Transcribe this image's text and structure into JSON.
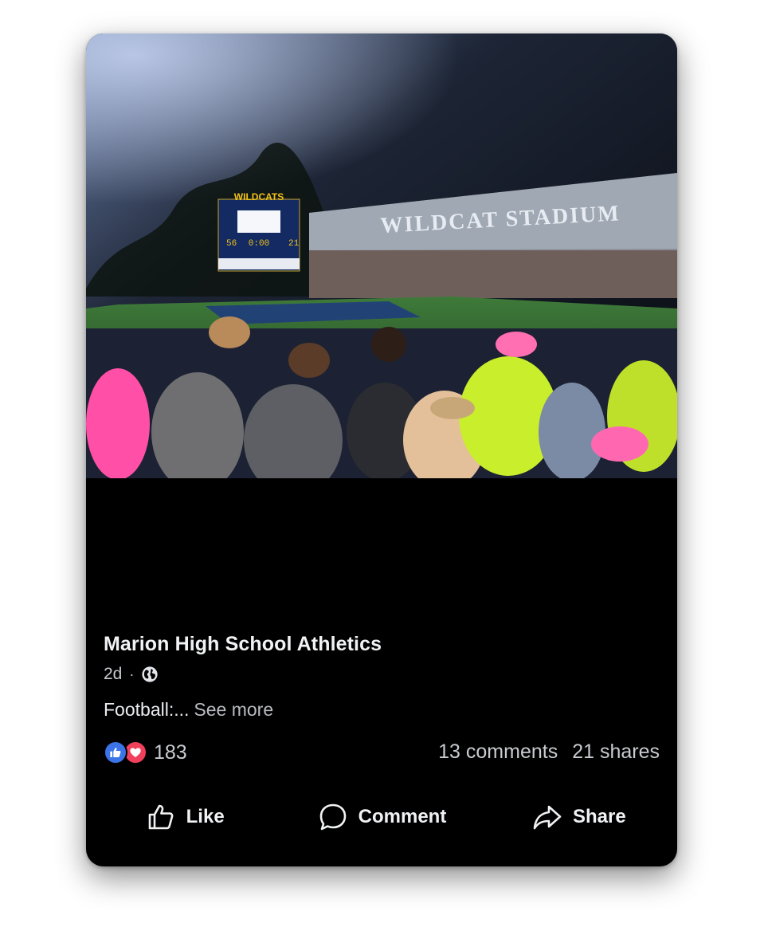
{
  "post": {
    "page_name": "Marion High School Athletics",
    "time_ago": "2d",
    "separator": "·",
    "privacy_icon": "globe-icon",
    "caption": "Football:...",
    "see_more": "See more",
    "photo": {
      "scoreboard_title": "WILDCATS",
      "building_sign": "WILDCAT STADIUM",
      "scoreboard_home_score": "56",
      "scoreboard_clock": "0:00",
      "scoreboard_away_score": "21"
    }
  },
  "stats": {
    "reaction_icons": [
      "like-reaction-icon",
      "love-reaction-icon"
    ],
    "reaction_count": "183",
    "comments": "13 comments",
    "shares": "21 shares"
  },
  "actions": {
    "like_label": "Like",
    "comment_label": "Comment",
    "share_label": "Share"
  },
  "colors": {
    "background": "#000000",
    "like_blue": "#3b74e6",
    "love_red": "#f0405b",
    "text_primary": "#f1f2f4",
    "text_secondary": "#c8cbd0"
  }
}
